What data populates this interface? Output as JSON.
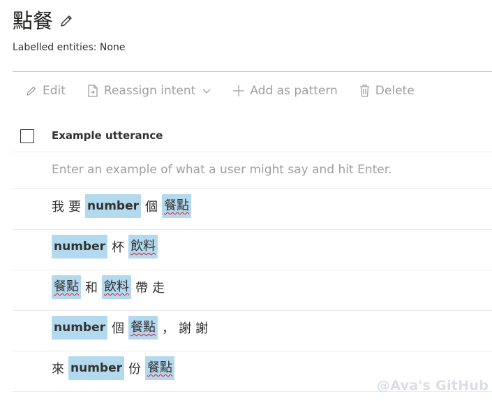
{
  "page": {
    "title": "點餐",
    "subtitle": "Labelled entities: None"
  },
  "toolbar": {
    "edit_label": "Edit",
    "reassign_label": "Reassign intent",
    "add_pattern_label": "Add as pattern",
    "delete_label": "Delete"
  },
  "table": {
    "column_header": "Example utterance",
    "input_placeholder": "Enter an example of what a user might say and hit Enter."
  },
  "utterances": [
    [
      {
        "t": "text",
        "v": "我"
      },
      {
        "t": "text",
        "v": "要"
      },
      {
        "t": "entity",
        "v": "number"
      },
      {
        "t": "text",
        "v": "個"
      },
      {
        "t": "entity",
        "v": "餐點"
      }
    ],
    [
      {
        "t": "entity",
        "v": "number"
      },
      {
        "t": "text",
        "v": "杯"
      },
      {
        "t": "entity",
        "v": "飲料"
      }
    ],
    [
      {
        "t": "entity",
        "v": "餐點"
      },
      {
        "t": "text",
        "v": "和"
      },
      {
        "t": "entity",
        "v": "飲料"
      },
      {
        "t": "text",
        "v": "帶"
      },
      {
        "t": "text",
        "v": "走"
      }
    ],
    [
      {
        "t": "entity",
        "v": "number"
      },
      {
        "t": "text",
        "v": "個"
      },
      {
        "t": "entity",
        "v": "餐點"
      },
      {
        "t": "text",
        "v": "，"
      },
      {
        "t": "text",
        "v": "謝"
      },
      {
        "t": "text",
        "v": "謝"
      }
    ],
    [
      {
        "t": "text",
        "v": "來"
      },
      {
        "t": "entity",
        "v": "number"
      },
      {
        "t": "text",
        "v": "份"
      },
      {
        "t": "entity",
        "v": "餐點"
      }
    ]
  ],
  "watermark": "@Ava's GitHub"
}
